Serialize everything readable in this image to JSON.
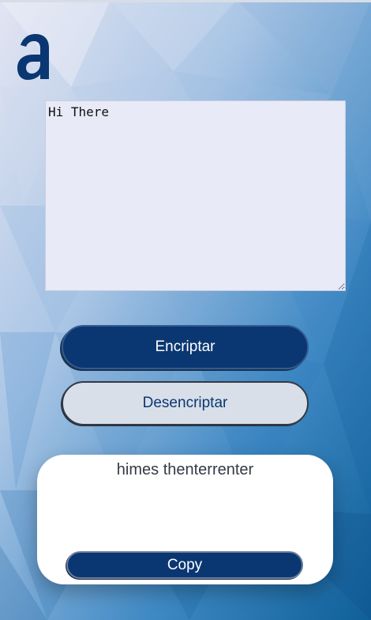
{
  "app": {
    "logo_icon": "alura-a-logo-icon",
    "colors": {
      "primary": "#0a3772",
      "secondary": "#d8dfe9",
      "background": "#9fbde0"
    }
  },
  "input": {
    "value": "Hi There"
  },
  "actions": {
    "encrypt_label": "Encriptar",
    "decrypt_label": "Desencriptar"
  },
  "output": {
    "text": "himes thenterrenter",
    "copy_label": "Copy"
  }
}
